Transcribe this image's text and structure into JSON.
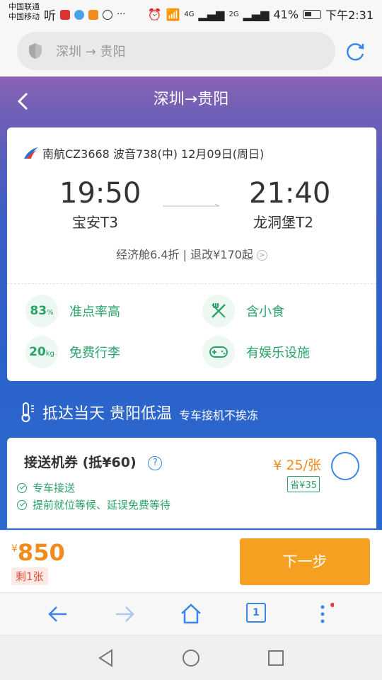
{
  "status_bar": {
    "carrier1": "中国联通",
    "carrier2": "中国移动",
    "icon_text": "听",
    "signal_4g": "4G",
    "signal_2g": "2G",
    "battery": "41%",
    "time": "下午2:31",
    "more": "···"
  },
  "browser": {
    "address": "深圳 → 贵阳",
    "tab_count": "1"
  },
  "header": {
    "title": "深圳→贵阳"
  },
  "flight": {
    "info": "南航CZ3668 波音738(中) 12月09日(周日)",
    "dep_time": "19:50",
    "arr_time": "21:40",
    "dep_airport": "宝安T3",
    "arr_airport": "龙洞堡T2",
    "fare": "经济舱6.4折",
    "sep": "|",
    "change_fee": "退改¥170起",
    "info_arrow": ">"
  },
  "features": {
    "ontime_value": "83",
    "ontime_unit": "%",
    "ontime_label": "准点率高",
    "meal_label": "含小食",
    "baggage_value": "20",
    "baggage_unit": "kg",
    "baggage_label": "免费行李",
    "entertainment_label": "有娱乐设施"
  },
  "promo": {
    "title": "抵达当天 贵阳低温",
    "subtitle": "专车接机不挨冻"
  },
  "transfer": {
    "title": "接送机券 (抵¥60)",
    "help": "?",
    "price": "¥ 25/张",
    "save": "省¥35",
    "line1": "专车接送",
    "line2": "提前就位等候、延误免费等待"
  },
  "pay": {
    "currency": "¥",
    "amount": "850",
    "remain": "剩1张",
    "next": "下一步"
  },
  "colors": {
    "accent_blue": "#3a86e6",
    "green": "#2aa36a",
    "orange": "#f5a021"
  }
}
